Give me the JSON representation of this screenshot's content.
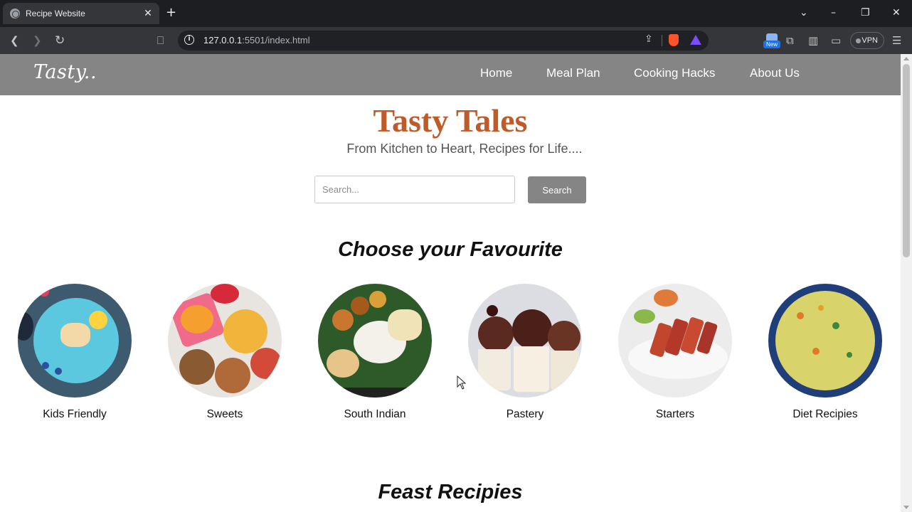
{
  "browser": {
    "tab_title": "Recipe Website",
    "url_host": "127.0.0.1",
    "url_rest": ":5501/index.html",
    "vpn_label": "VPN",
    "new_badge": "New"
  },
  "site": {
    "logo": "Tasty..",
    "nav": [
      "Home",
      "Meal Plan",
      "Cooking Hacks",
      "About Us"
    ],
    "hero_title": "Tasty Tales",
    "hero_subtitle": "From Kitchen to Heart, Recipes for Life....",
    "search_placeholder": "Search...",
    "search_button": "Search",
    "choose_title": "Choose your Favourite",
    "categories": [
      "Kids Friendly",
      "Sweets",
      "South Indian",
      "Pastery",
      "Starters",
      "Diet Recipies"
    ],
    "feast_title": "Feast Recipies"
  },
  "colors": {
    "navbar": "#858585",
    "hero_title": "#c05a28",
    "button": "#858585"
  }
}
